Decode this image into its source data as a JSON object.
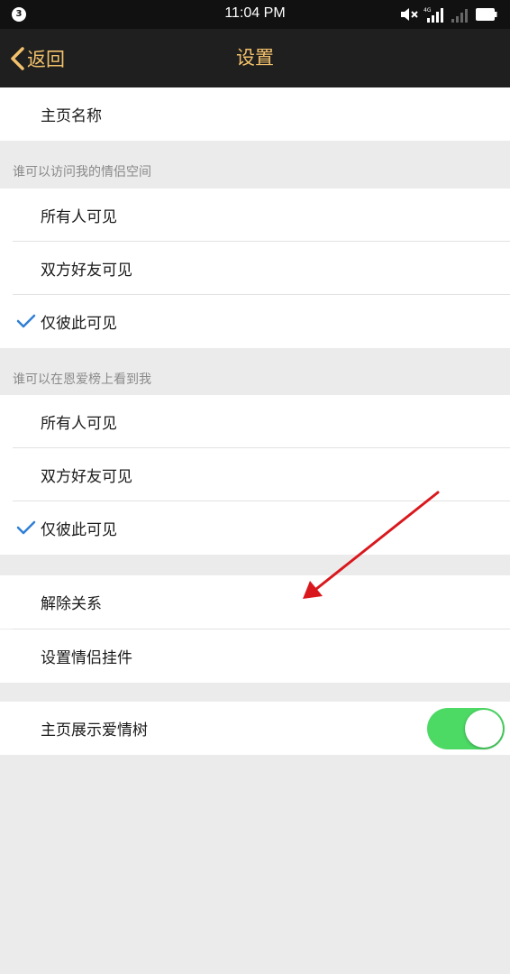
{
  "status_bar": {
    "notification_count": "3",
    "time": "11:04 PM",
    "icons": [
      "mute-icon",
      "signal-4g-icon",
      "signal-icon",
      "battery-icon"
    ]
  },
  "nav": {
    "back_label": "返回",
    "title": "设置",
    "accent_color": "#f3c16b"
  },
  "homepage_name": {
    "label": "主页名称"
  },
  "visit_section": {
    "header": "谁可以访问我的情侣空间",
    "options": [
      {
        "label": "所有人可见",
        "selected": false
      },
      {
        "label": "双方好友可见",
        "selected": false
      },
      {
        "label": "仅彼此可见",
        "selected": true
      }
    ]
  },
  "ranking_section": {
    "header": "谁可以在恩爱榜上看到我",
    "options": [
      {
        "label": "所有人可见",
        "selected": false
      },
      {
        "label": "双方好友可见",
        "selected": false
      },
      {
        "label": "仅彼此可见",
        "selected": true
      }
    ]
  },
  "actions": {
    "unbind_label": "解除关系",
    "widget_label": "设置情侣挂件"
  },
  "love_tree": {
    "label": "主页展示爱情树",
    "enabled": true,
    "toggle_color": "#4cd964"
  },
  "check_color": "#2f7fd6",
  "arrow_color": "#d9181e"
}
